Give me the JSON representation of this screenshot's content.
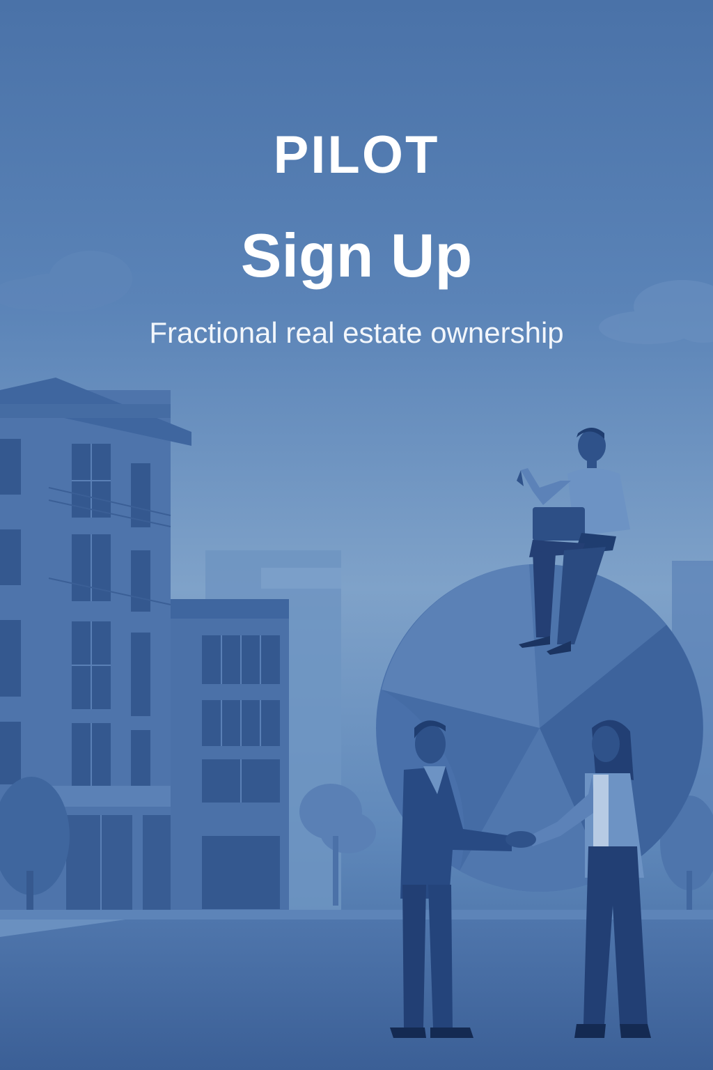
{
  "screen": {
    "brand": "PILOT",
    "title": "Sign Up",
    "subtitle": "Fractional real estate ownership"
  },
  "illustration": {
    "subject": "city-buildings-pie-chart-handshake"
  },
  "colors": {
    "background_top": "#4a72a8",
    "background_mid": "#7fa2c9",
    "ground": "#3f67a0",
    "text": "#ffffff"
  }
}
